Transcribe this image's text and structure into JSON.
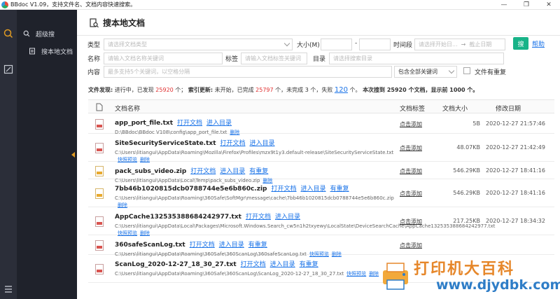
{
  "window": {
    "title": "BBdoc V1.09，支持文件名、文档内容快速搜索。"
  },
  "sidebar": {
    "items": [
      {
        "label": "超级搜",
        "icon": "search-icon"
      },
      {
        "label": "搜本地文档",
        "icon": "document-list-icon"
      }
    ]
  },
  "page": {
    "title": "搜本地文档"
  },
  "filters": {
    "type_label": "类型",
    "type_placeholder": "请选择文档类型",
    "size_label": "大小(M)",
    "size_sep": "-",
    "time_label": "时间段",
    "time_start_placeholder": "请选择开始日...",
    "time_arrow": "→",
    "time_end_placeholder": "截止日期",
    "search_button": "搜",
    "help_link": "帮助",
    "name_label": "名称",
    "name_placeholder": "请输入文档名称关键词",
    "tag_label": "标签",
    "tag_placeholder": "请输入文档标签关键词",
    "dir_label": "目录",
    "dir_placeholder": "请选择搜索目录",
    "content_label": "内容",
    "content_placeholder": "最多支持5个关键词，以空格分隔",
    "match_value": "包含全部关键词",
    "duplicate_label": "文件有重复"
  },
  "status": {
    "discover_label": "文件发现:",
    "discover_text_1": "进行中，已发现",
    "discover_count": "25920",
    "discover_text_2": "个；",
    "index_label": "索引更新:",
    "index_text_1": "未开始，已完成",
    "index_done": "25797",
    "index_text_2": "个，未完成",
    "index_pending": "3",
    "index_text_3": "个，失败",
    "index_failed": "120",
    "index_text_4": "个。",
    "summary": "本次搜到 25920 个文档，显示前 1000 个。"
  },
  "table": {
    "headers": {
      "name": "文档名称",
      "tag": "文档标签",
      "size": "文档大小",
      "date": "修改日期"
    },
    "rows": [
      {
        "name": "app_port_file.txt",
        "actions": [
          "打开文档",
          "进入目录"
        ],
        "path": "D:\\BBdoc\\BBdoc V108\\config\\app_port_file.txt",
        "path_links": [
          "删除"
        ],
        "tag": "点击添加",
        "size": "5B",
        "date": "2020-12-27 21:57:46",
        "kind": "txt"
      },
      {
        "name": "SiteSecurityServiceState.txt",
        "actions": [
          "打开文档",
          "进入目录"
        ],
        "path": "C:\\Users\\litiangui\\AppData\\Roaming\\Mozilla\\Firefox\\Profiles\\mzx9t1y3.default-release\\SiteSecurityServiceState.txt",
        "path_links": [
          "快照预览",
          "删除"
        ],
        "tag": "点击添加",
        "size": "48.07KB",
        "date": "2020-12-27 21:42:49",
        "kind": "txt"
      },
      {
        "name": "pack_subs_video.zip",
        "actions": [
          "打开文档",
          "进入目录",
          "有重复"
        ],
        "path": "C:\\Users\\litiangui\\AppData\\Local\\Temp\\pack_subs_video.zip",
        "path_links": [
          "删除"
        ],
        "tag": "点击添加",
        "size": "546.29KB",
        "date": "2020-12-27 18:41:16",
        "kind": "zip"
      },
      {
        "name": "7bb46b1020815dcb0788744e5e6b860c.zip",
        "actions": [
          "打开文档",
          "进入目录",
          "有重复"
        ],
        "path": "C:\\Users\\litiangui\\AppData\\Roaming\\360Safe\\SoftMgr\\message\\cache\\7bb46b1020815dcb0788744e5e6b860c.zip",
        "path_links": [
          "删除"
        ],
        "tag": "点击添加",
        "size": "546.29KB",
        "date": "2020-12-27 18:41:16",
        "kind": "zip"
      },
      {
        "name": "AppCache132535388684242977.txt",
        "actions": [
          "打开文档",
          "进入目录"
        ],
        "path": "C:\\Users\\litiangui\\AppData\\Local\\Packages\\Microsoft.Windows.Search_cw5n1h2txyewy\\LocalState\\DeviceSearchCache\\AppCache132535388684242977.txt",
        "path_links": [
          "快照预览",
          "删除"
        ],
        "tag": "点击添加",
        "size": "217.25KB",
        "date": "2020-12-27 18:34:32",
        "kind": "txt"
      },
      {
        "name": "360safeScanLog.txt",
        "actions": [
          "打开文档",
          "进入目录",
          "有重复"
        ],
        "path": "C:\\Users\\litiangui\\AppData\\Roaming\\360Safe\\360ScanLog\\360safeScanLog.txt",
        "path_links": [
          "快照预览",
          "删除"
        ],
        "tag": "点击添加",
        "size": "",
        "date": "",
        "kind": "txt"
      },
      {
        "name": "ScanLog_2020-12-27_18_30_27.txt",
        "actions": [
          "打开文档",
          "进入目录",
          "有重复"
        ],
        "path": "C:\\Users\\litiangui\\AppData\\Roaming\\360Safe\\360ScanLog\\ScanLog_2020-12-27_18_30_27.txt",
        "path_links": [
          "快照预览",
          "删除"
        ],
        "tag": "",
        "size": "",
        "date": "",
        "kind": "txt"
      }
    ]
  },
  "watermark": {
    "text": "打印机大百科",
    "url": "www.djydbk.com"
  },
  "colors": {
    "accent": "#18b388",
    "link": "#1a73e8",
    "rail_accent": "#e09b23",
    "sidebar_bg": "#1f222b",
    "danger": "#e03131"
  }
}
